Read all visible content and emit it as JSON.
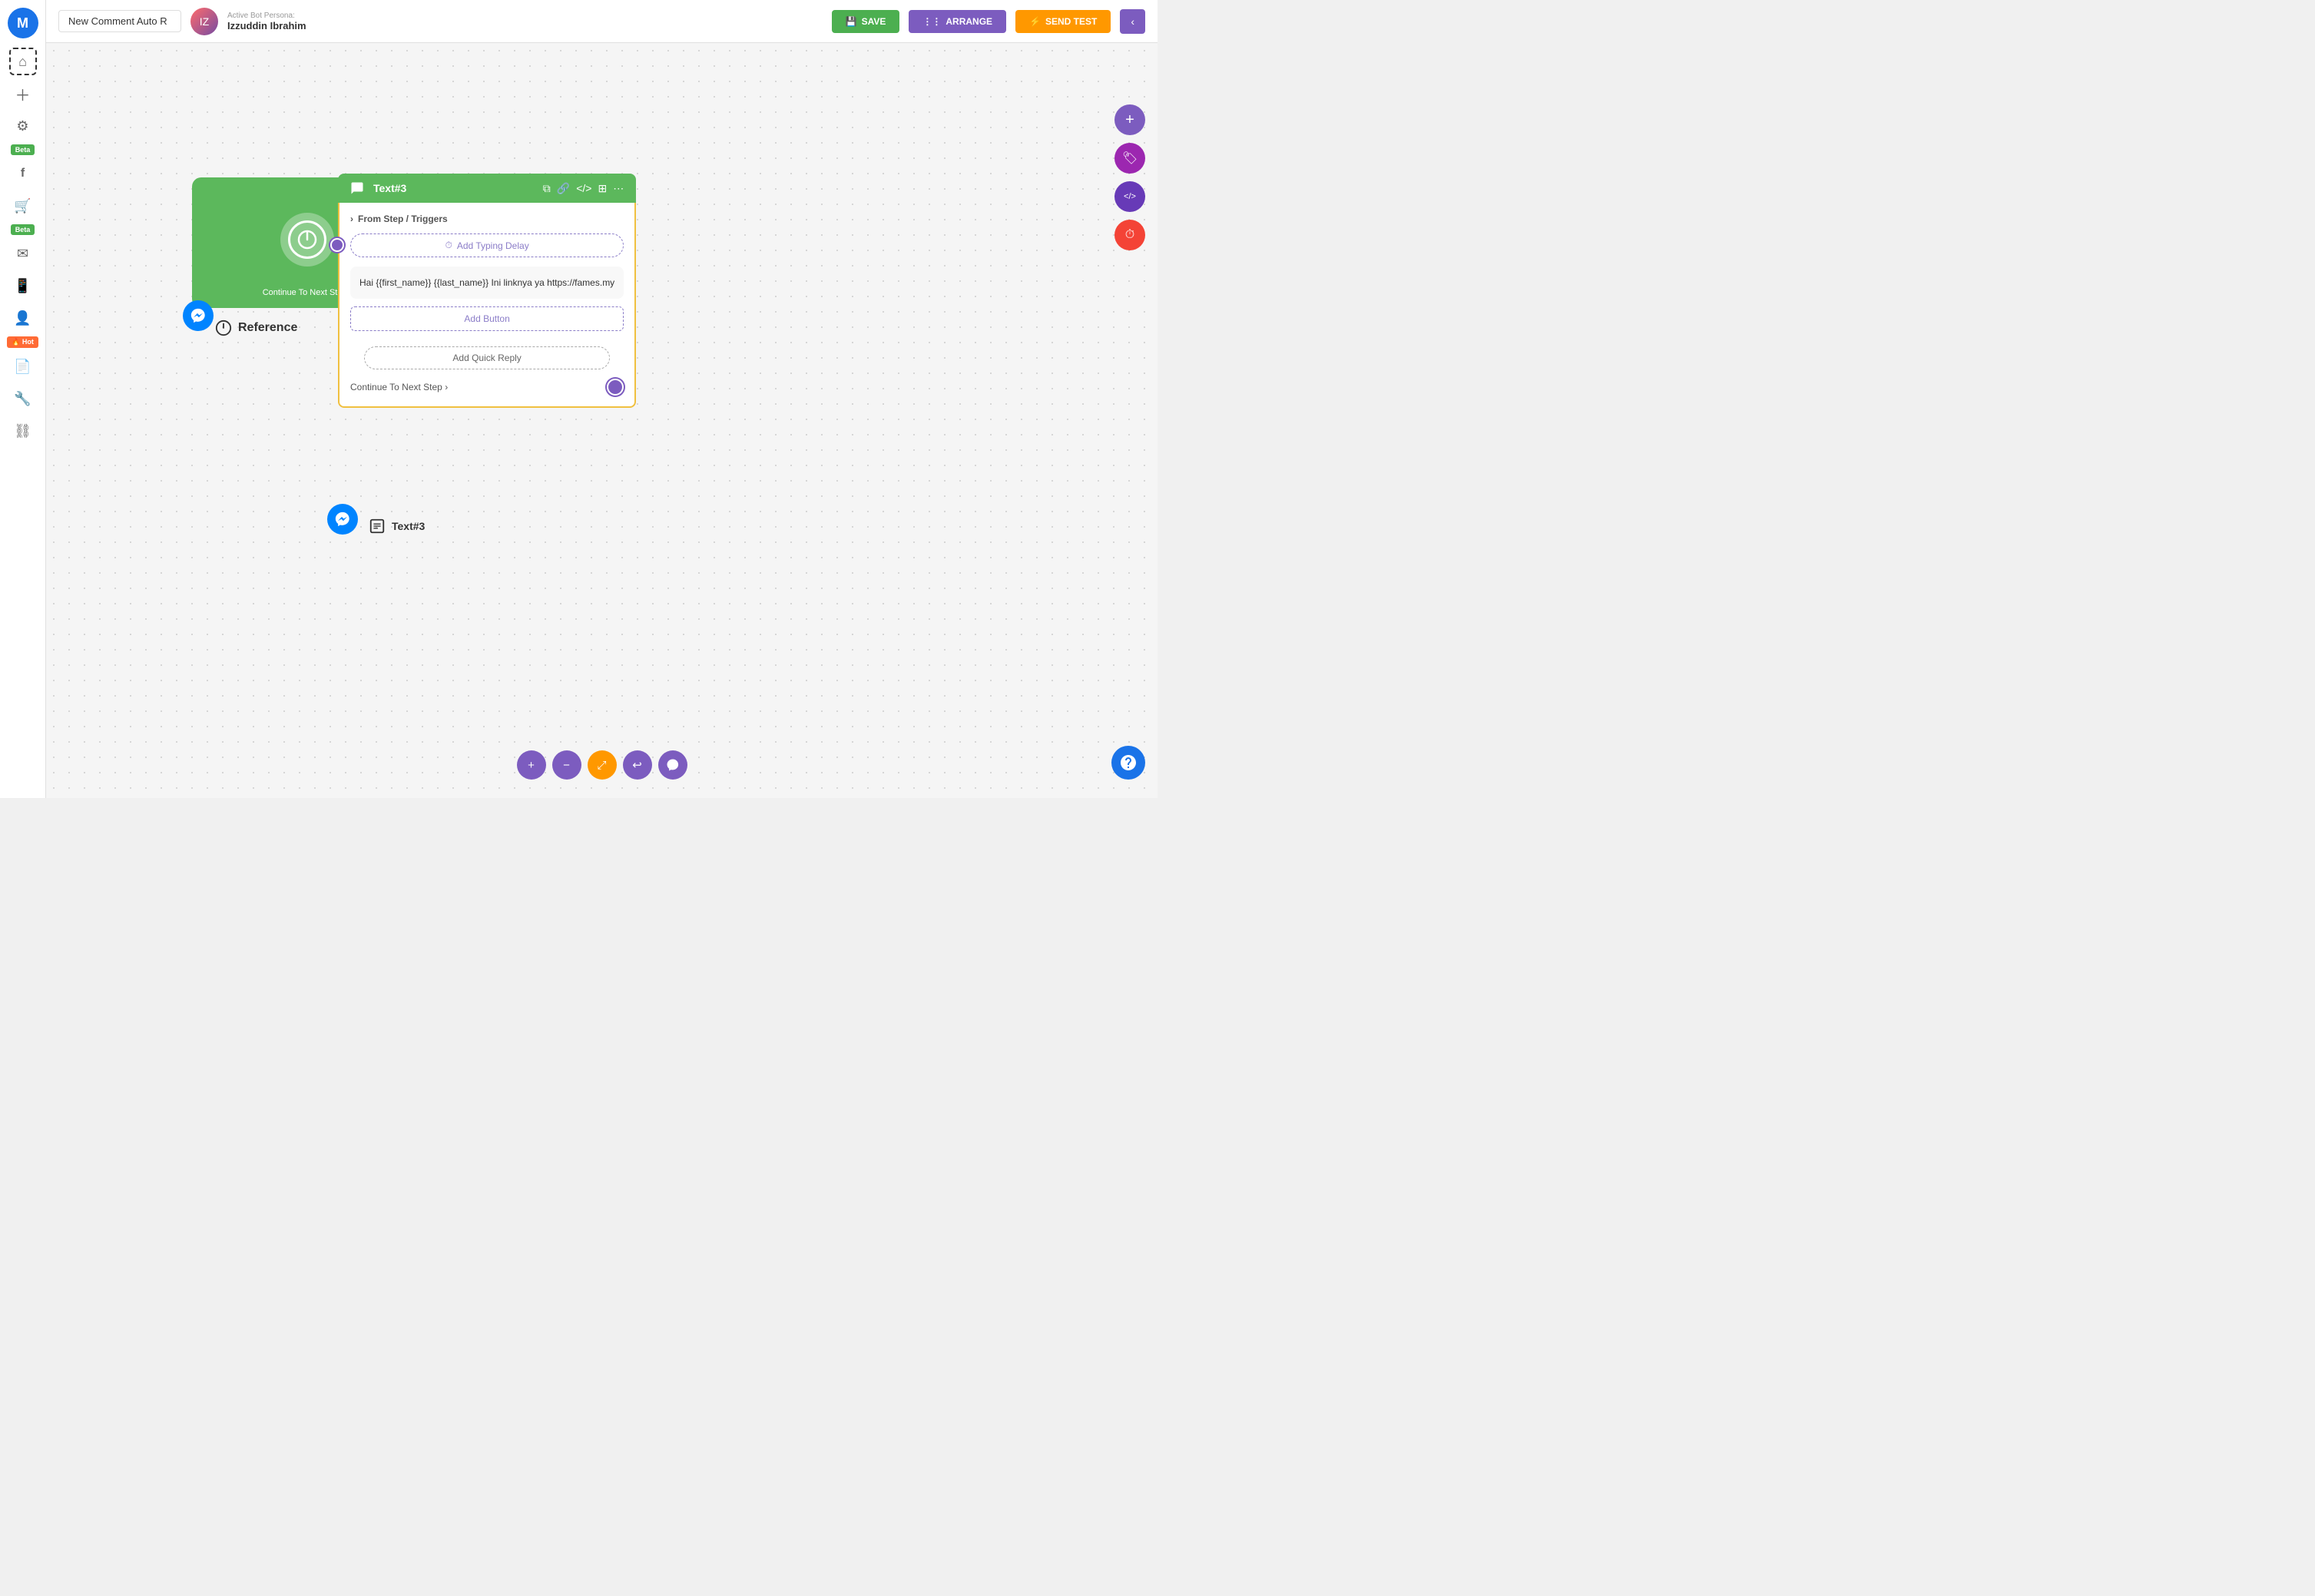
{
  "app": {
    "logo": "M",
    "logo_bg": "#1a73e8"
  },
  "header": {
    "flow_name": "New Comment Auto R",
    "flow_name_placeholder": "New Comment Auto R",
    "bot_persona_label": "Active Bot Persona:",
    "bot_persona_name": "Izzuddin Ibrahim",
    "save_label": "SAVE",
    "arrange_label": "ARRANGE",
    "send_test_label": "SEND TEST",
    "back_label": "‹"
  },
  "sidebar": {
    "items": [
      {
        "id": "home",
        "icon": "⌂",
        "active": true
      },
      {
        "id": "add",
        "icon": "＋"
      },
      {
        "id": "settings",
        "icon": "⚙"
      },
      {
        "id": "beta1",
        "label": "Beta"
      },
      {
        "id": "facebook",
        "icon": "f"
      },
      {
        "id": "cart",
        "icon": "🛒"
      },
      {
        "id": "beta2",
        "label": "Beta"
      },
      {
        "id": "mail",
        "icon": "✉"
      },
      {
        "id": "phone",
        "icon": "📱"
      },
      {
        "id": "user",
        "icon": "👤"
      },
      {
        "id": "hot",
        "label": "🔥 Hot"
      },
      {
        "id": "document",
        "icon": "📄"
      },
      {
        "id": "tools",
        "icon": "🔧"
      },
      {
        "id": "network",
        "icon": "⛓"
      }
    ]
  },
  "canvas": {
    "start_node": {
      "continue_label": "Continue To Next Step ›",
      "reference_label": "Reference"
    },
    "text3_node": {
      "header_title": "Text#3",
      "from_step_label": "From Step / Triggers",
      "typing_delay_label": "Add Typing Delay",
      "message_text": "Hai {{first_name}} {{last_name}} Ini linknya ya https://fames.my",
      "add_button_label": "Add Button",
      "add_quick_reply_label": "Add Quick Reply",
      "continue_label": "Continue To Next Step ›",
      "below_label": "Text#3"
    }
  },
  "right_float": {
    "add_label": "+",
    "tag_label": "🏷",
    "code_label": "</>",
    "timer_label": "⏱"
  },
  "bottom_toolbar": {
    "zoom_in": "+",
    "zoom_out": "−",
    "center": "⤢",
    "undo": "↩",
    "messenger": "m"
  }
}
